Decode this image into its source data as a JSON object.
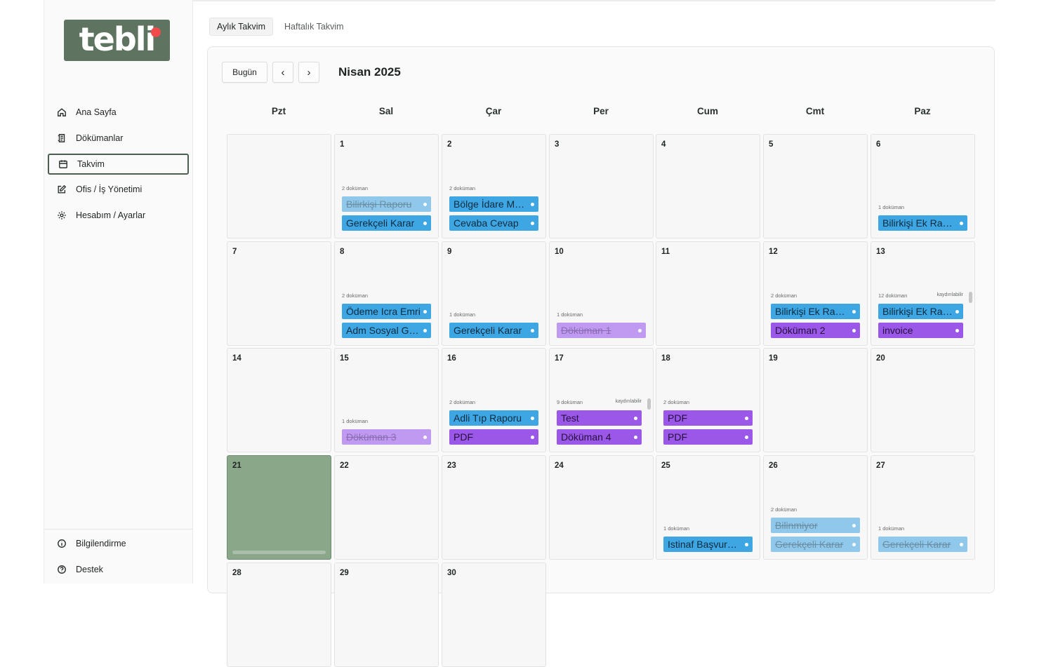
{
  "logo": {
    "text": "tebli",
    "dot_color": "#f04a4a",
    "bg_color": "#5e7360"
  },
  "sidebar": {
    "items": [
      {
        "label": "Ana Sayfa",
        "icon": "home-icon"
      },
      {
        "label": "Dökümanlar",
        "icon": "document-icon"
      },
      {
        "label": "Takvim",
        "icon": "calendar-icon",
        "active": true
      },
      {
        "label": "Ofis / İş Yönetimi",
        "icon": "edit-icon"
      },
      {
        "label": "Hesabım / Ayarlar",
        "icon": "gear-icon"
      }
    ],
    "bottom_items": [
      {
        "label": "Bilgilendirme",
        "icon": "info-icon"
      },
      {
        "label": "Destek",
        "icon": "help-icon"
      }
    ]
  },
  "tabs": [
    {
      "label": "Aylık Takvim",
      "active": true
    },
    {
      "label": "Haftalık Takvim",
      "active": false
    }
  ],
  "toolbar": {
    "today_label": "Bugün",
    "prev_label": "‹",
    "next_label": "›",
    "month_title": "Nisan 2025"
  },
  "weekdays": [
    "Pzt",
    "Sal",
    "Çar",
    "Per",
    "Cum",
    "Cmt",
    "Paz"
  ],
  "colors": {
    "blue": "#3ea6e3",
    "purple": "#9b57e8",
    "today": "#8aa78a"
  },
  "weeks": [
    [
      {
        "day": ""
      },
      {
        "day": "1",
        "count": "2 doküman",
        "events": [
          {
            "title": "Bilirkişi Raporu",
            "color": "blue",
            "done": true
          },
          {
            "title": "Gerekçeli Karar",
            "color": "blue"
          }
        ]
      },
      {
        "day": "2",
        "count": "2 doküman",
        "events": [
          {
            "title": "Bölge İdare Mahkemesi",
            "color": "blue"
          },
          {
            "title": "Cevaba Cevap",
            "color": "blue"
          }
        ]
      },
      {
        "day": "3"
      },
      {
        "day": "4"
      },
      {
        "day": "5"
      },
      {
        "day": "6",
        "count": "1 doküman",
        "events": [
          {
            "title": "Bilirkişi Ek Raporu",
            "color": "blue"
          }
        ]
      }
    ],
    [
      {
        "day": "7"
      },
      {
        "day": "8",
        "count": "2 doküman",
        "events": [
          {
            "title": "Ödeme Icra Emri",
            "color": "blue"
          },
          {
            "title": "Adm Sosyal Güvenlik",
            "color": "blue"
          }
        ]
      },
      {
        "day": "9",
        "count": "1 doküman",
        "events": [
          {
            "title": "Gerekçeli Karar",
            "color": "blue"
          }
        ]
      },
      {
        "day": "10",
        "count": "1 doküman",
        "events": [
          {
            "title": "Döküman 1",
            "color": "purple",
            "done": true
          }
        ]
      },
      {
        "day": "11"
      },
      {
        "day": "12",
        "count": "2 doküman",
        "events": [
          {
            "title": "Bilirkişi Ek Raporu",
            "color": "blue"
          },
          {
            "title": "Döküman 2",
            "color": "purple"
          }
        ]
      },
      {
        "day": "13",
        "count": "12 doküman",
        "scroll": "kaydırılabilir",
        "events": [
          {
            "title": "Bilirkişi Ek Raporu",
            "color": "blue"
          },
          {
            "title": "invoice",
            "color": "purple"
          }
        ]
      }
    ],
    [
      {
        "day": "14"
      },
      {
        "day": "15",
        "count": "1 doküman",
        "events": [
          {
            "title": "Döküman 3",
            "color": "purple",
            "done": true
          }
        ]
      },
      {
        "day": "16",
        "count": "2 doküman",
        "events": [
          {
            "title": "Adli Tıp Raporu",
            "color": "blue"
          },
          {
            "title": "PDF",
            "color": "purple"
          }
        ]
      },
      {
        "day": "17",
        "count": "9 doküman",
        "scroll": "kaydırılabilir",
        "events": [
          {
            "title": "Test",
            "color": "purple"
          },
          {
            "title": "Döküman 4",
            "color": "purple"
          }
        ]
      },
      {
        "day": "18",
        "count": "2 doküman",
        "events": [
          {
            "title": "PDF",
            "color": "purple"
          },
          {
            "title": "PDF",
            "color": "purple"
          }
        ]
      },
      {
        "day": "19"
      },
      {
        "day": "20"
      }
    ],
    [
      {
        "day": "21",
        "today": true
      },
      {
        "day": "22"
      },
      {
        "day": "23"
      },
      {
        "day": "24"
      },
      {
        "day": "25",
        "count": "1 doküman",
        "events": [
          {
            "title": "Istinaf Başvurusu",
            "color": "blue"
          }
        ]
      },
      {
        "day": "26",
        "count": "2 doküman",
        "events": [
          {
            "title": "Bilinmiyor",
            "color": "blue",
            "done": true
          },
          {
            "title": "Gerekçeli Karar",
            "color": "blue",
            "done": true
          }
        ]
      },
      {
        "day": "27",
        "count": "1 doküman",
        "events": [
          {
            "title": "Gerekçeli Karar",
            "color": "blue",
            "done": true
          }
        ]
      }
    ],
    [
      {
        "day": "28"
      },
      {
        "day": "29"
      },
      {
        "day": "30"
      }
    ]
  ]
}
